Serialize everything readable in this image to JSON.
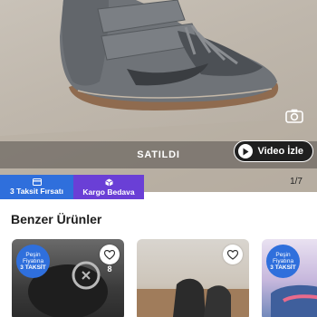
{
  "listing": {
    "status_label": "SATILDI",
    "video_label": "Video İzle",
    "image_counter": "1/7",
    "badges": [
      {
        "label": "3 Taksit Fırsatı",
        "icon": "card-icon",
        "color": "#2f6fdc"
      },
      {
        "label": "Kargo Bedava",
        "icon": "box-icon",
        "color": "#6a3fd6"
      }
    ]
  },
  "similar": {
    "title": "Benzer Ürünler",
    "items": [
      {
        "badge": [
          "Peşin",
          "Fiyatına",
          "3 TAKSİT"
        ],
        "fav_count": "8"
      },
      {
        "fav_count": ""
      },
      {
        "badge": [
          "Peşin",
          "Fiyatına",
          "3 TAKSİT"
        ]
      }
    ]
  }
}
